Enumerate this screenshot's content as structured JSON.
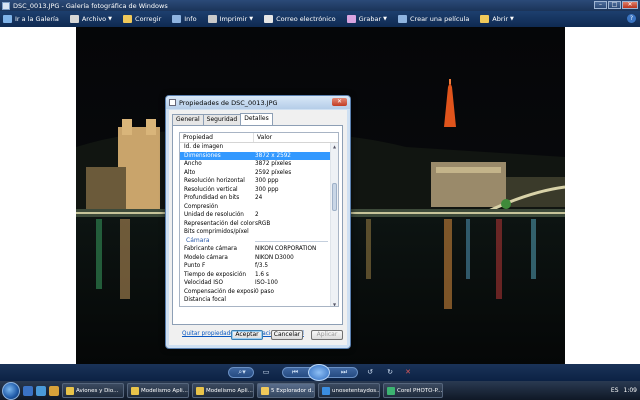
{
  "window": {
    "title": "DSC_0013.JPG - Galería fotográfica de Windows"
  },
  "toolbar": {
    "items": [
      {
        "label": "Ir a la Galería",
        "icon": "back-arrow-icon",
        "caret": false,
        "color": "#7fb3e8"
      },
      {
        "label": "Archivo",
        "icon": "file-icon",
        "caret": true,
        "color": "#d7d7d7"
      },
      {
        "label": "Corregir",
        "icon": "fix-icon",
        "caret": false,
        "color": "#f0c95a"
      },
      {
        "label": "Info",
        "icon": "info-icon",
        "caret": false,
        "color": "#8fb4e0"
      },
      {
        "label": "Imprimir",
        "icon": "printer-icon",
        "caret": true,
        "color": "#c9c9c9"
      },
      {
        "label": "Correo electrónico",
        "icon": "email-icon",
        "caret": false,
        "color": "#e6e6e6"
      },
      {
        "label": "Grabar",
        "icon": "disc-icon",
        "caret": true,
        "color": "#d9a4e0"
      },
      {
        "label": "Crear una película",
        "icon": "film-icon",
        "caret": false,
        "color": "#8fb4e0"
      },
      {
        "label": "Abrir",
        "icon": "open-icon",
        "caret": true,
        "color": "#f0c95a"
      }
    ]
  },
  "dialog": {
    "title": "Propiedades de DSC_0013.JPG",
    "tabs": [
      "General",
      "Seguridad",
      "Detalles"
    ],
    "active_tab": "Detalles",
    "columns": [
      "Propiedad",
      "Valor"
    ],
    "rows": [
      {
        "prop": "Id. de imagen",
        "val": "",
        "type": "row"
      },
      {
        "prop": "Dimensiones",
        "val": "3872 x 2592",
        "type": "selected"
      },
      {
        "prop": "Ancho",
        "val": "3872 píxeles",
        "type": "row"
      },
      {
        "prop": "Alto",
        "val": "2592 píxeles",
        "type": "row"
      },
      {
        "prop": "Resolución horizontal",
        "val": "300 ppp",
        "type": "row"
      },
      {
        "prop": "Resolución vertical",
        "val": "300 ppp",
        "type": "row"
      },
      {
        "prop": "Profundidad en bits",
        "val": "24",
        "type": "row"
      },
      {
        "prop": "Compresión",
        "val": "",
        "type": "row"
      },
      {
        "prop": "Unidad de resolución",
        "val": "2",
        "type": "row"
      },
      {
        "prop": "Representación del color",
        "val": "sRGB",
        "type": "row"
      },
      {
        "prop": "Bits comprimidos/píxel",
        "val": "",
        "type": "row"
      },
      {
        "prop": "Cámara",
        "val": "",
        "type": "section"
      },
      {
        "prop": "Fabricante cámara",
        "val": "NIKON CORPORATION",
        "type": "row"
      },
      {
        "prop": "Modelo cámara",
        "val": "NIKON D3000",
        "type": "row"
      },
      {
        "prop": "Punto F",
        "val": "f/3.5",
        "type": "row"
      },
      {
        "prop": "Tiempo de exposición",
        "val": "1.6 s",
        "type": "row"
      },
      {
        "prop": "Velocidad ISO",
        "val": "ISO-100",
        "type": "row"
      },
      {
        "prop": "Compensación de exposición",
        "val": "0 paso",
        "type": "row"
      },
      {
        "prop": "Distancia focal",
        "val": "",
        "type": "row"
      }
    ],
    "link": "Quitar propiedades e información personal",
    "buttons": {
      "accept": "Aceptar",
      "cancel": "Cancelar",
      "apply": "Aplicar"
    }
  },
  "taskbar": {
    "tasks": [
      {
        "label": "Aviones y Dio...",
        "color": "#e8c34a",
        "active": false
      },
      {
        "label": "Modelismo Apli...",
        "color": "#e8c34a",
        "active": false
      },
      {
        "label": "Modelismo Apli...",
        "color": "#e8c34a",
        "active": false
      },
      {
        "label": "5 Explorador d...",
        "color": "#f0c95a",
        "active": true
      },
      {
        "label": "unosetentaydos...",
        "color": "#3a8de0",
        "active": false
      },
      {
        "label": "Corel PHOTO-P...",
        "color": "#3cb371",
        "active": false
      }
    ],
    "tray": {
      "lang": "ES",
      "time": "1:09"
    }
  }
}
